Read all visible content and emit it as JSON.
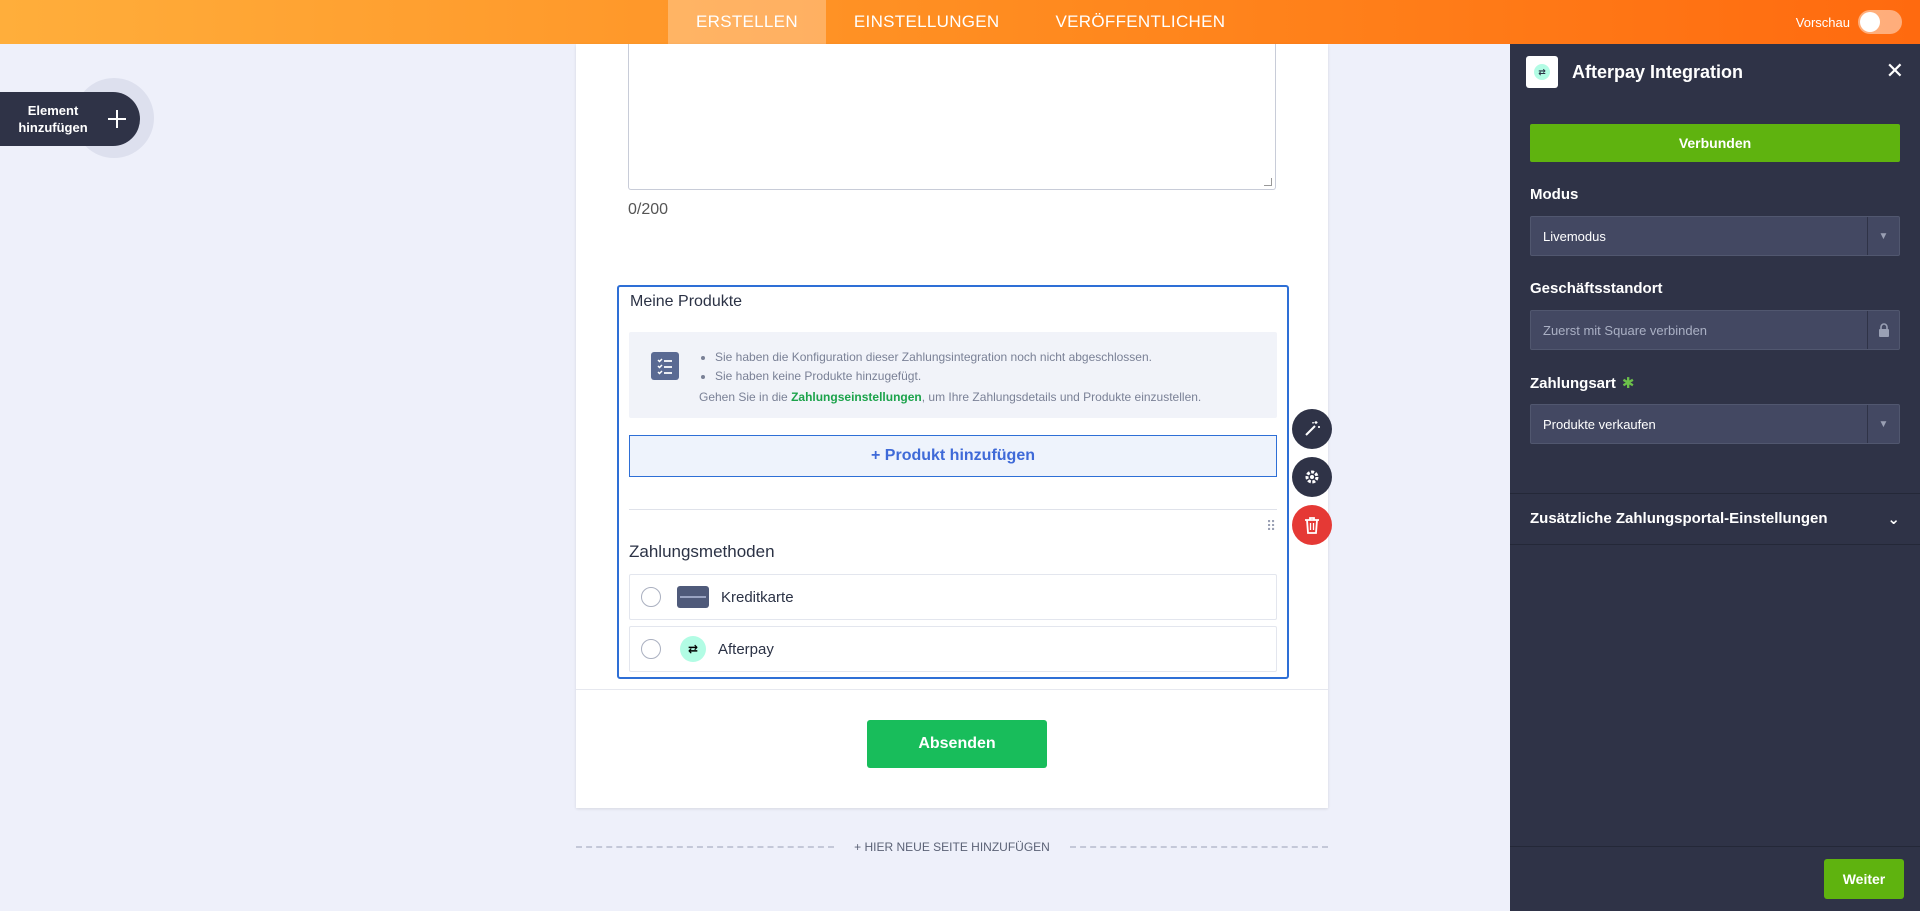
{
  "topbar": {
    "tabs": [
      {
        "label": "ERSTELLEN",
        "active": true
      },
      {
        "label": "EINSTELLUNGEN",
        "active": false
      },
      {
        "label": "VERÖFFENTLICHEN",
        "active": false
      }
    ],
    "preview_label": "Vorschau"
  },
  "add_element": {
    "label": "Element hinzufügen",
    "icon": "plus-icon"
  },
  "form": {
    "char_counter": "0/200",
    "product_section_title": "Meine Produkte",
    "notice": {
      "items": [
        "Sie haben die Konfiguration dieser Zahlungsintegration noch nicht abgeschlossen.",
        "Sie haben keine Produkte hinzugefügt."
      ],
      "hint_prefix": "Gehen Sie in die ",
      "hint_link": "Zahlungseinstellungen",
      "hint_suffix": ", um Ihre Zahlungsdetails und Produkte einzustellen."
    },
    "add_product_label": "+ Produkt hinzufügen",
    "payment_methods_title": "Zahlungsmethoden",
    "payment_methods": [
      {
        "label": "Kreditkarte",
        "icon": "credit-card-icon"
      },
      {
        "label": "Afterpay",
        "icon": "afterpay-icon"
      }
    ],
    "submit_label": "Absenden",
    "new_page_label": "+ HIER NEUE SEITE HINZUFÜGEN"
  },
  "panel": {
    "title": "Afterpay Integration",
    "connected_label": "Verbunden",
    "mode_label": "Modus",
    "mode_value": "Livemodus",
    "location_label": "Geschäftsstandort",
    "location_placeholder": "Zuerst mit Square verbinden",
    "payment_type_label": "Zahlungsart",
    "payment_type_value": "Produkte verkaufen",
    "extra_settings_label": "Zusätzliche Zahlungsportal-Einstellungen",
    "next_label": "Weiter"
  },
  "colors": {
    "topbar_start": "#ffae3b",
    "topbar_end": "#ff6a0f",
    "panel_bg": "#2f3347",
    "accent_green": "#5fb30f",
    "submit_green": "#18bd5b",
    "selection_blue": "#2e6fd6",
    "delete_red": "#e53935"
  }
}
